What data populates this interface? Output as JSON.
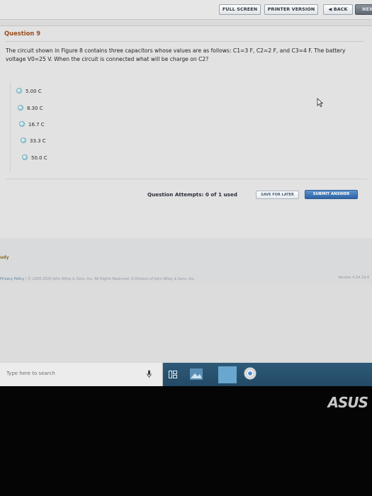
{
  "toolbar": {
    "full_screen": "FULL SCREEN",
    "printer_version": "PRINTER VERSION",
    "back": "◀ BACK",
    "next": "NEX"
  },
  "question": {
    "title": "Question 9",
    "text": "The circuit shown in Figure 8 contains three capacitors whose values are as follows: C1=3 F, C2=2 F, and C3=4 F. The battery voltage V0=25 V. When the circuit is connected what will be charge on C2?"
  },
  "choices": [
    {
      "label": "5.00 C"
    },
    {
      "label": "8.30 C"
    },
    {
      "label": "16.7 C"
    },
    {
      "label": "33.3 C"
    },
    {
      "label": "50.0 C"
    }
  ],
  "attempts": {
    "label": "Question Attempts: 0 of 1 used"
  },
  "buttons": {
    "save_later": "SAVE FOR LATER",
    "submit": "SUBMIT ANSWER"
  },
  "study_link": "udy",
  "footer": {
    "privacy": "Privacy Policy",
    "separator": "|",
    "copyright": "© 2000-2020 John Wiley & Sons, Inc. All Rights Reserved. A Division of John Wiley & Sons, Inc.",
    "version": "Version 4.24.19.4"
  },
  "taskbar": {
    "search_placeholder": "Type here to search"
  },
  "brand": {
    "logo_text": "ASUS"
  },
  "colors": {
    "question_title": "#9a4e1f",
    "submit_button": "#2e63a4",
    "taskbar": "#2e5a78"
  }
}
